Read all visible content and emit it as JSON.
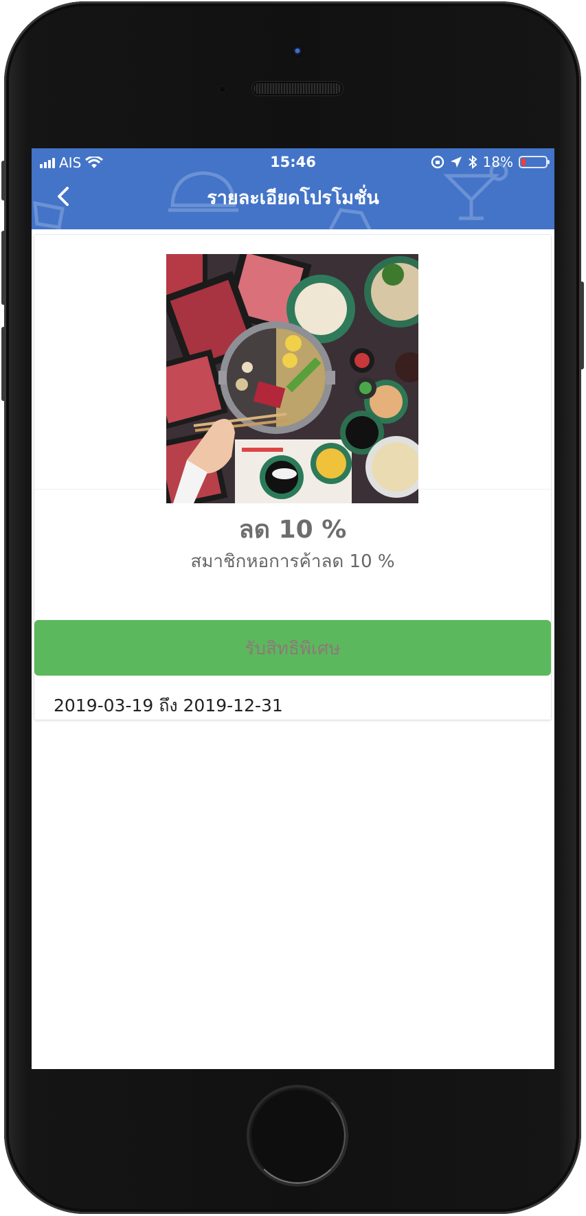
{
  "status_bar": {
    "carrier": "AIS",
    "time": "15:46",
    "battery_percent": "18%",
    "battery_level": 0.18,
    "battery_color": "#ff3b30"
  },
  "nav": {
    "title": "รายละเอียดโปรโมชั่น",
    "back_icon": "chevron-left-icon",
    "background_color": "#4374c8"
  },
  "promotion": {
    "title": "ลด 10 %",
    "subtitle": "สมาชิกหอการค้าลด 10 %",
    "redeem_label": "รับสิทธิพิเศษ",
    "redeem_color": "#5cb85c",
    "validity": "2019-03-19 ถึง 2019-12-31",
    "image_icon": "food-photo"
  }
}
